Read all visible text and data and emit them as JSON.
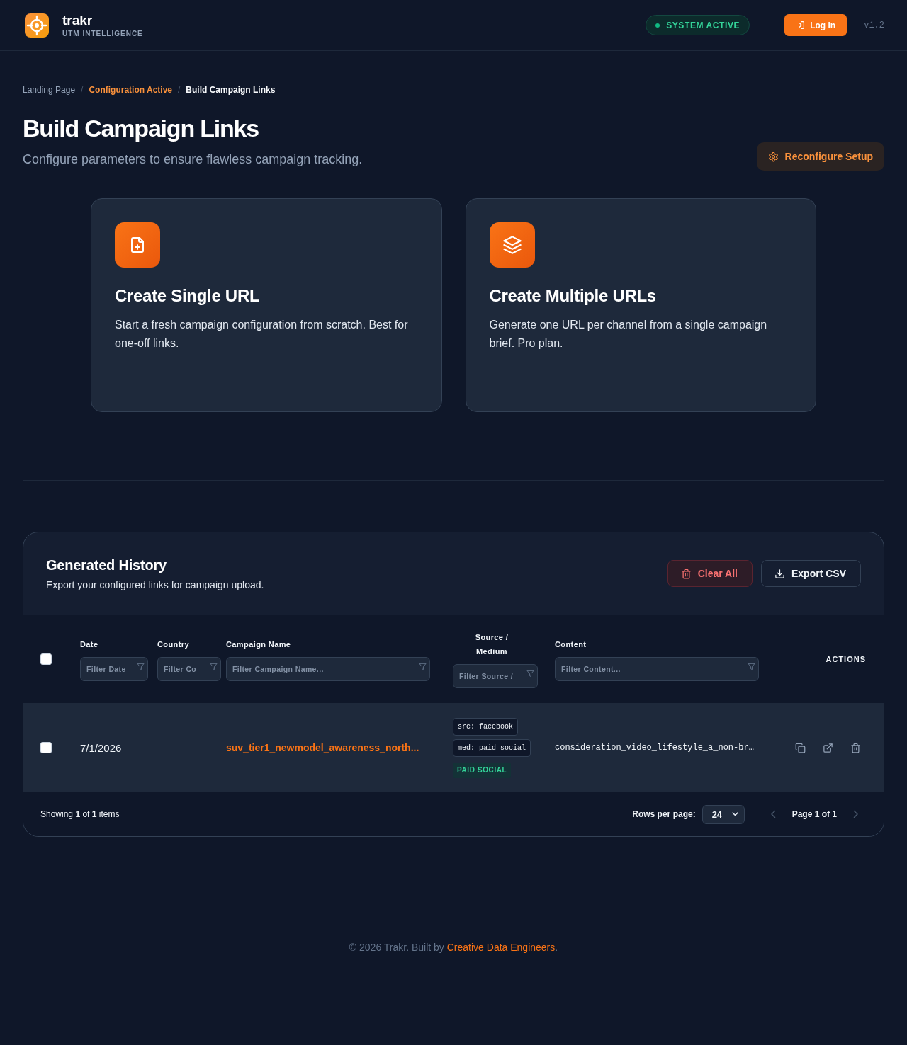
{
  "header": {
    "brand_name": "trakr",
    "brand_tagline": "UTM INTELLIGENCE",
    "status": "SYSTEM ACTIVE",
    "login_button": "Log in",
    "version": "v1.2"
  },
  "breadcrumb": [
    {
      "label": "Landing Page",
      "kind": "link"
    },
    {
      "label": "/",
      "kind": "separator"
    },
    {
      "label": "Configuration Active",
      "kind": "highlight"
    },
    {
      "label": "/",
      "kind": "separator"
    },
    {
      "label": "Build Campaign Links",
      "kind": "current"
    }
  ],
  "page": {
    "title": "Build Campaign Links",
    "subtitle": "Configure parameters to ensure flawless campaign tracking.",
    "reconfigure_button": "Reconfigure Setup"
  },
  "options": [
    {
      "title": "Create Single URL",
      "description": "Start a fresh campaign configuration from scratch. Best for one-off links."
    },
    {
      "title": "Create Multiple URLs",
      "description": "Generate one URL per channel from a single campaign brief. Pro plan."
    }
  ],
  "history": {
    "title": "Generated History",
    "subtitle": "Export your configured links for campaign upload.",
    "buttons": [
      {
        "label": "Clear All",
        "kind": "danger"
      },
      {
        "label": "Export CSV",
        "kind": "outline"
      }
    ],
    "table": {
      "select_all": {
        "checked": false
      },
      "columns": [
        {
          "label": "Date",
          "placeholder": "Filter Date"
        },
        {
          "label": "Country",
          "placeholder": "Filter Co"
        },
        {
          "label": "Campaign Name",
          "placeholder": "Filter Campaign Name..."
        },
        {
          "label": "Source / Medium",
          "placeholder": "Filter Source /"
        },
        {
          "label": "Content",
          "placeholder": "Filter Content..."
        },
        {
          "label": "ACTIONS"
        }
      ],
      "rows": [
        {
          "checked": false,
          "date": "7/1/2026",
          "campaign_name": "suv_tier1_newmodel_awareness_north...",
          "source": "src: facebook",
          "medium": "med: paid-social",
          "channel": "PAID SOCIAL",
          "content": "consideration_video_lifestyle_a_non-br…"
        }
      ]
    },
    "footer": {
      "showing": "Showing **1** of **1** items",
      "rows_per_page_label": "Rows per page:",
      "rows_per_page": "24",
      "page_label": "Page 1 of 1",
      "prev_disabled": true,
      "next_disabled": true
    }
  },
  "footer": {
    "text": "© 2026 Trakr. Built by ",
    "link": "Creative Data Engineers",
    "end": "."
  }
}
